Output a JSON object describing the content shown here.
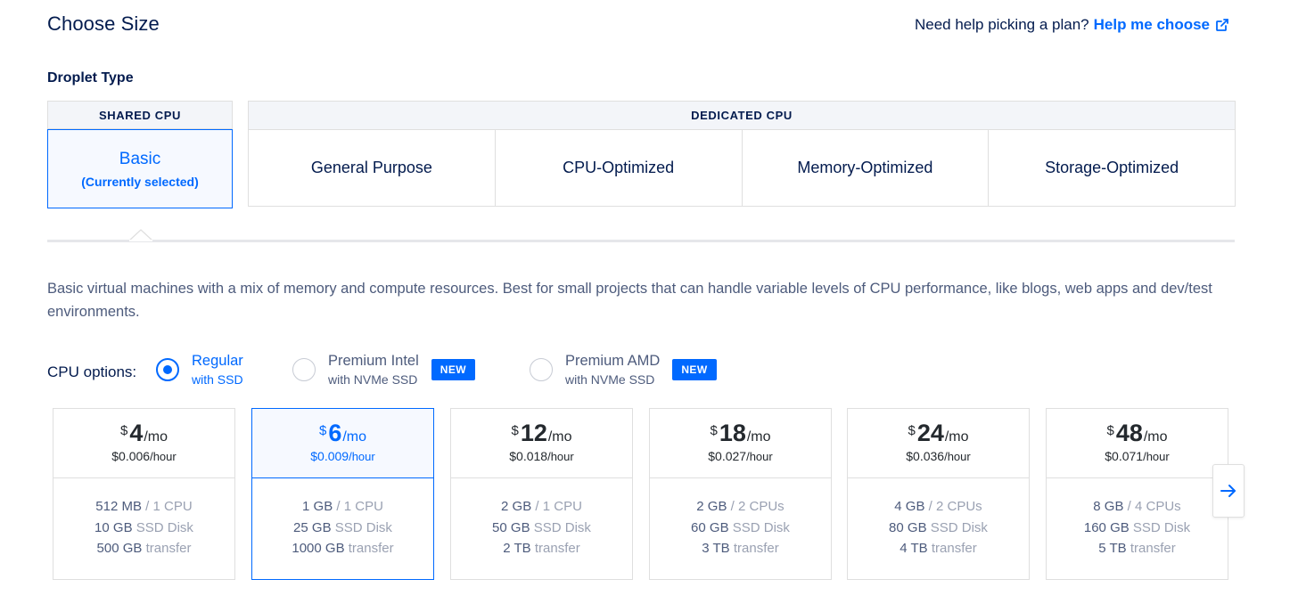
{
  "header": {
    "title": "Choose Size",
    "help_prompt": "Need help picking a plan?",
    "help_link": "Help me choose",
    "help_icon": "external-link-icon"
  },
  "droplet_type": {
    "label": "Droplet Type",
    "shared_header": "SHARED CPU",
    "basic_label": "Basic",
    "basic_status": "(Currently selected)",
    "dedicated_header": "DEDICATED CPU",
    "dedicated_options": [
      "General Purpose",
      "CPU-Optimized",
      "Memory-Optimized",
      "Storage-Optimized"
    ]
  },
  "description": "Basic virtual machines with a mix of memory and compute resources. Best for small projects that can handle variable levels of CPU performance, like blogs, web apps and dev/test environments.",
  "cpu_options": {
    "label": "CPU options:",
    "options": [
      {
        "name": "Regular",
        "sub": "with SSD",
        "selected": true,
        "badge": ""
      },
      {
        "name": "Premium Intel",
        "sub": "with NVMe SSD",
        "selected": false,
        "badge": "NEW"
      },
      {
        "name": "Premium AMD",
        "sub": "with NVMe SSD",
        "selected": false,
        "badge": "NEW"
      }
    ]
  },
  "plans": [
    {
      "currency": "$",
      "price": "4",
      "period": "/mo",
      "hourly": "$0.006",
      "hourly_unit": "/hour",
      "memory": "512 MB",
      "cpu": "1 CPU",
      "disk": "10 GB",
      "disk_type": "SSD Disk",
      "transfer": "500 GB",
      "transfer_label": "transfer",
      "selected": false
    },
    {
      "currency": "$",
      "price": "6",
      "period": "/mo",
      "hourly": "$0.009",
      "hourly_unit": "/hour",
      "memory": "1 GB",
      "cpu": "1 CPU",
      "disk": "25 GB",
      "disk_type": "SSD Disk",
      "transfer": "1000 GB",
      "transfer_label": "transfer",
      "selected": true
    },
    {
      "currency": "$",
      "price": "12",
      "period": "/mo",
      "hourly": "$0.018",
      "hourly_unit": "/hour",
      "memory": "2 GB",
      "cpu": "1 CPU",
      "disk": "50 GB",
      "disk_type": "SSD Disk",
      "transfer": "2 TB",
      "transfer_label": "transfer",
      "selected": false
    },
    {
      "currency": "$",
      "price": "18",
      "period": "/mo",
      "hourly": "$0.027",
      "hourly_unit": "/hour",
      "memory": "2 GB",
      "cpu": "2 CPUs",
      "disk": "60 GB",
      "disk_type": "SSD Disk",
      "transfer": "3 TB",
      "transfer_label": "transfer",
      "selected": false
    },
    {
      "currency": "$",
      "price": "24",
      "period": "/mo",
      "hourly": "$0.036",
      "hourly_unit": "/hour",
      "memory": "4 GB",
      "cpu": "2 CPUs",
      "disk": "80 GB",
      "disk_type": "SSD Disk",
      "transfer": "4 TB",
      "transfer_label": "transfer",
      "selected": false
    },
    {
      "currency": "$",
      "price": "48",
      "period": "/mo",
      "hourly": "$0.071",
      "hourly_unit": "/hour",
      "memory": "8 GB",
      "cpu": "4 CPUs",
      "disk": "160 GB",
      "disk_type": "SSD Disk",
      "transfer": "5 TB",
      "transfer_label": "transfer",
      "selected": false
    }
  ],
  "carousel": {
    "next_icon": "arrow-right-icon"
  },
  "colors": {
    "accent": "#0069ff",
    "text_dark": "#031b4e",
    "text_muted": "#4d5b7c",
    "text_dim": "#9aa1b2",
    "border": "#dfdfdf",
    "selected_bg": "#f6f9ff"
  }
}
